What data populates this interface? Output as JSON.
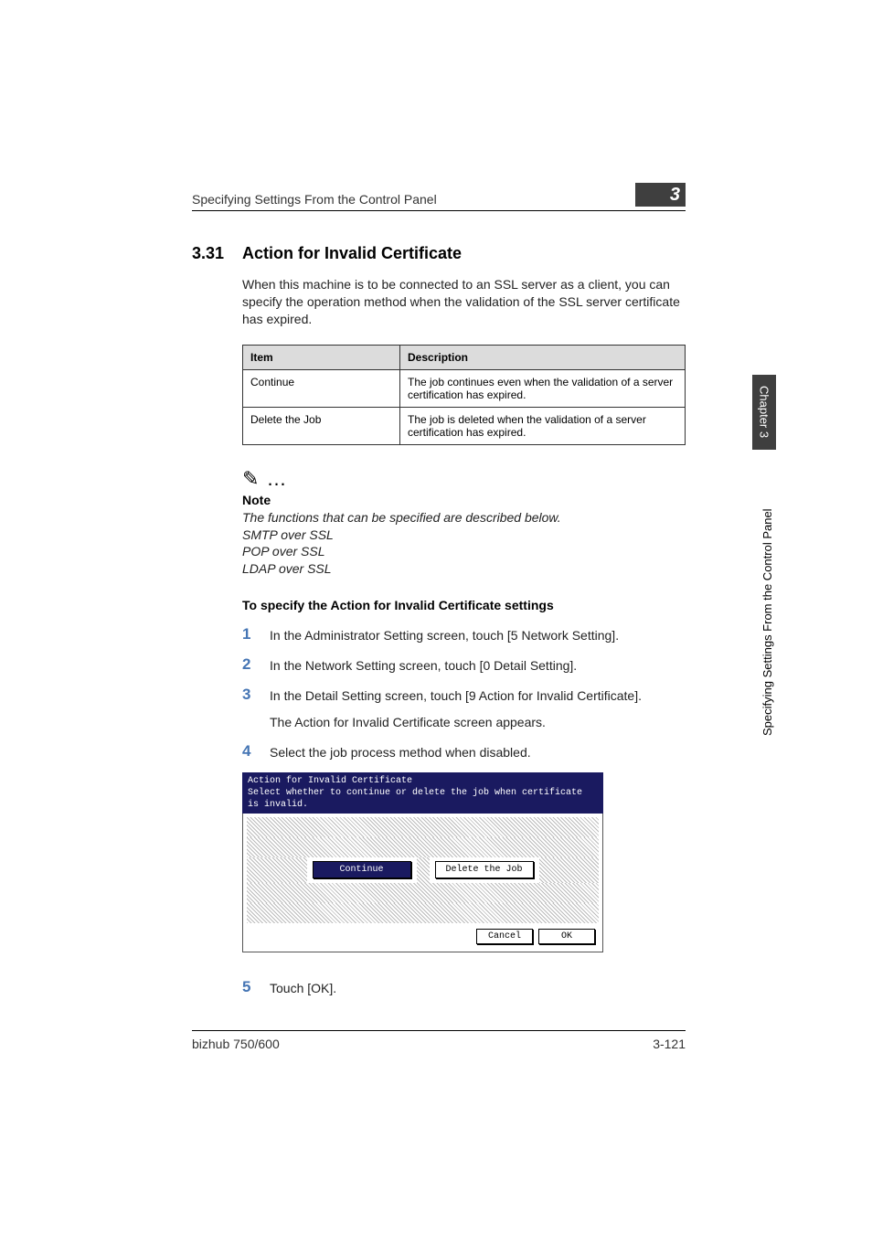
{
  "header": {
    "running_head": "Specifying Settings From the Control Panel",
    "chapter_number": "3"
  },
  "section": {
    "number": "3.31",
    "title": "Action for Invalid Certificate",
    "intro": "When this machine is to be connected to an SSL server as a client, you can specify the operation method when the validation of the SSL server certificate has expired."
  },
  "table": {
    "headers": {
      "col1": "Item",
      "col2": "Description"
    },
    "rows": [
      {
        "item": "Continue",
        "desc": "The job continues even when the validation of a server certification has expired."
      },
      {
        "item": "Delete the Job",
        "desc": "The job is deleted when the validation of a server certification has expired."
      }
    ]
  },
  "note": {
    "icon": "✎ …",
    "heading": "Note",
    "line1": "The functions that can be specified are described below.",
    "line2": "SMTP over SSL",
    "line3": "POP over SSL",
    "line4": "LDAP over SSL"
  },
  "subhead": "To specify the Action for Invalid Certificate settings",
  "steps": [
    {
      "n": "1",
      "text": "In the Administrator Setting screen, touch [5 Network Setting]."
    },
    {
      "n": "2",
      "text": "In the Network Setting screen, touch [0 Detail Setting]."
    },
    {
      "n": "3",
      "text": "In the Detail Setting screen, touch [9 Action for Invalid Certificate].",
      "text2": "The Action for Invalid Certificate screen appears."
    },
    {
      "n": "4",
      "text": "Select the job process method when disabled."
    }
  ],
  "screen": {
    "title": "Action for Invalid Certificate",
    "subtitle": "Select whether to continue or delete the job when certificate is invalid.",
    "btn_continue": "Continue",
    "btn_delete": "Delete the Job",
    "btn_cancel": "Cancel",
    "btn_ok": "OK"
  },
  "step5": {
    "n": "5",
    "text": "Touch [OK]."
  },
  "side": {
    "chapter": "Chapter 3",
    "label": "Specifying Settings From the Control Panel"
  },
  "footer": {
    "model": "bizhub 750/600",
    "page": "3-121"
  }
}
